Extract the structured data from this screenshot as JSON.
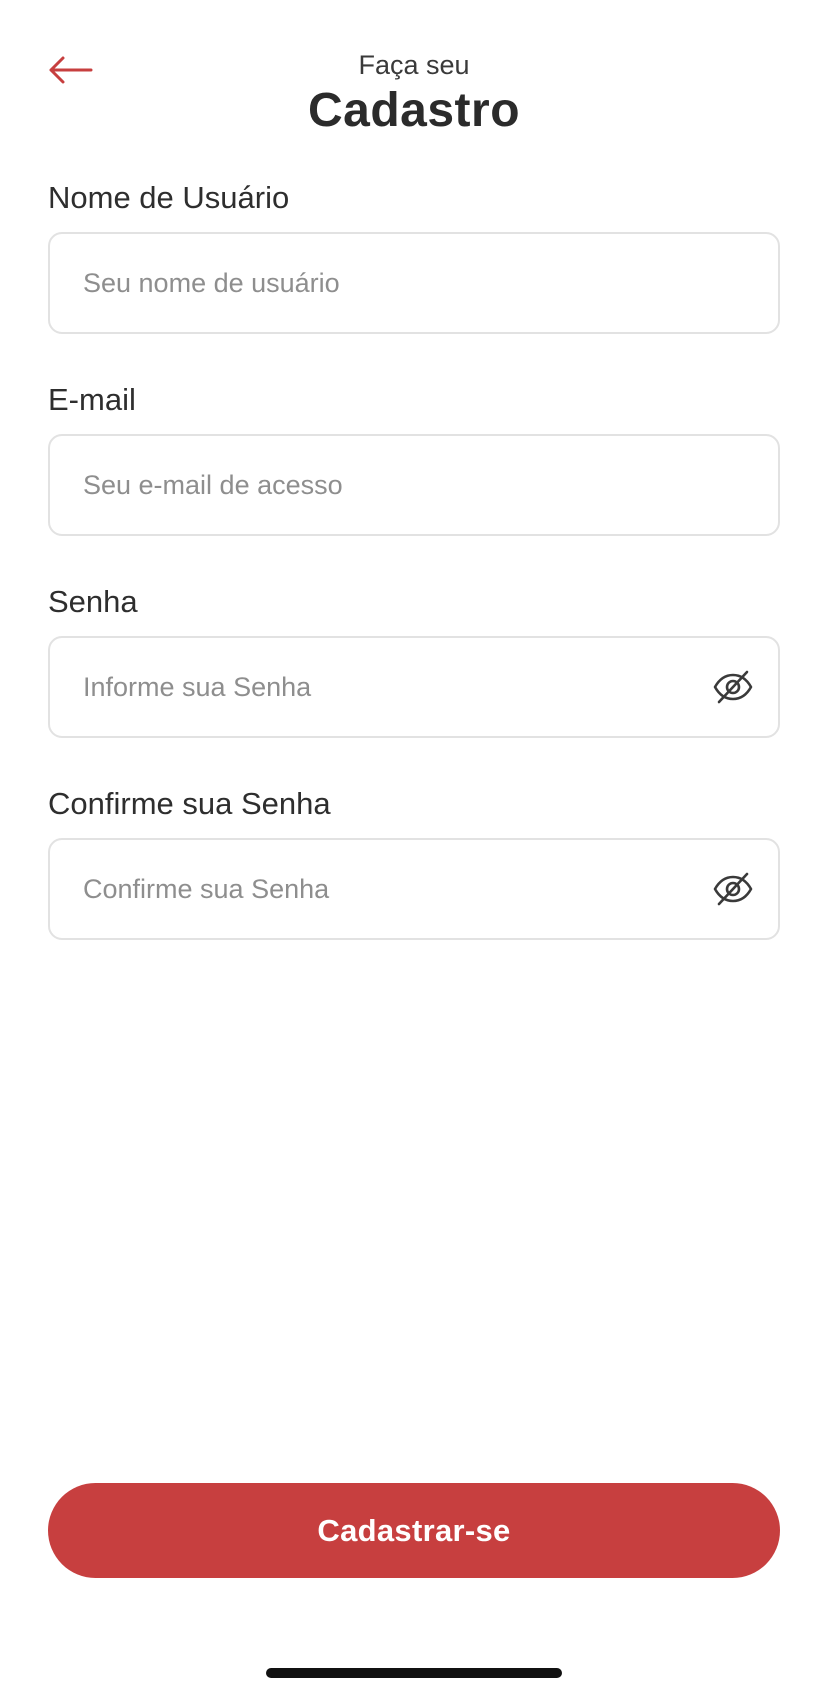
{
  "header": {
    "subtitle": "Faça seu",
    "title": "Cadastro",
    "back_icon": "arrow-left-icon"
  },
  "form": {
    "username": {
      "label": "Nome de Usuário",
      "placeholder": "Seu nome de usuário",
      "value": ""
    },
    "email": {
      "label": "E-mail",
      "placeholder": "Seu e-mail de acesso",
      "value": ""
    },
    "password": {
      "label": "Senha",
      "placeholder": "Informe sua Senha",
      "value": "",
      "toggle_icon": "eye-off-icon"
    },
    "confirm_password": {
      "label": "Confirme sua Senha",
      "placeholder": "Confirme sua Senha",
      "value": "",
      "toggle_icon": "eye-off-icon"
    }
  },
  "actions": {
    "submit_label": "Cadastrar-se"
  },
  "colors": {
    "accent": "#c73f3f",
    "text": "#2b2b2b",
    "placeholder": "#8e8e8e",
    "border": "#e2e2e2"
  }
}
